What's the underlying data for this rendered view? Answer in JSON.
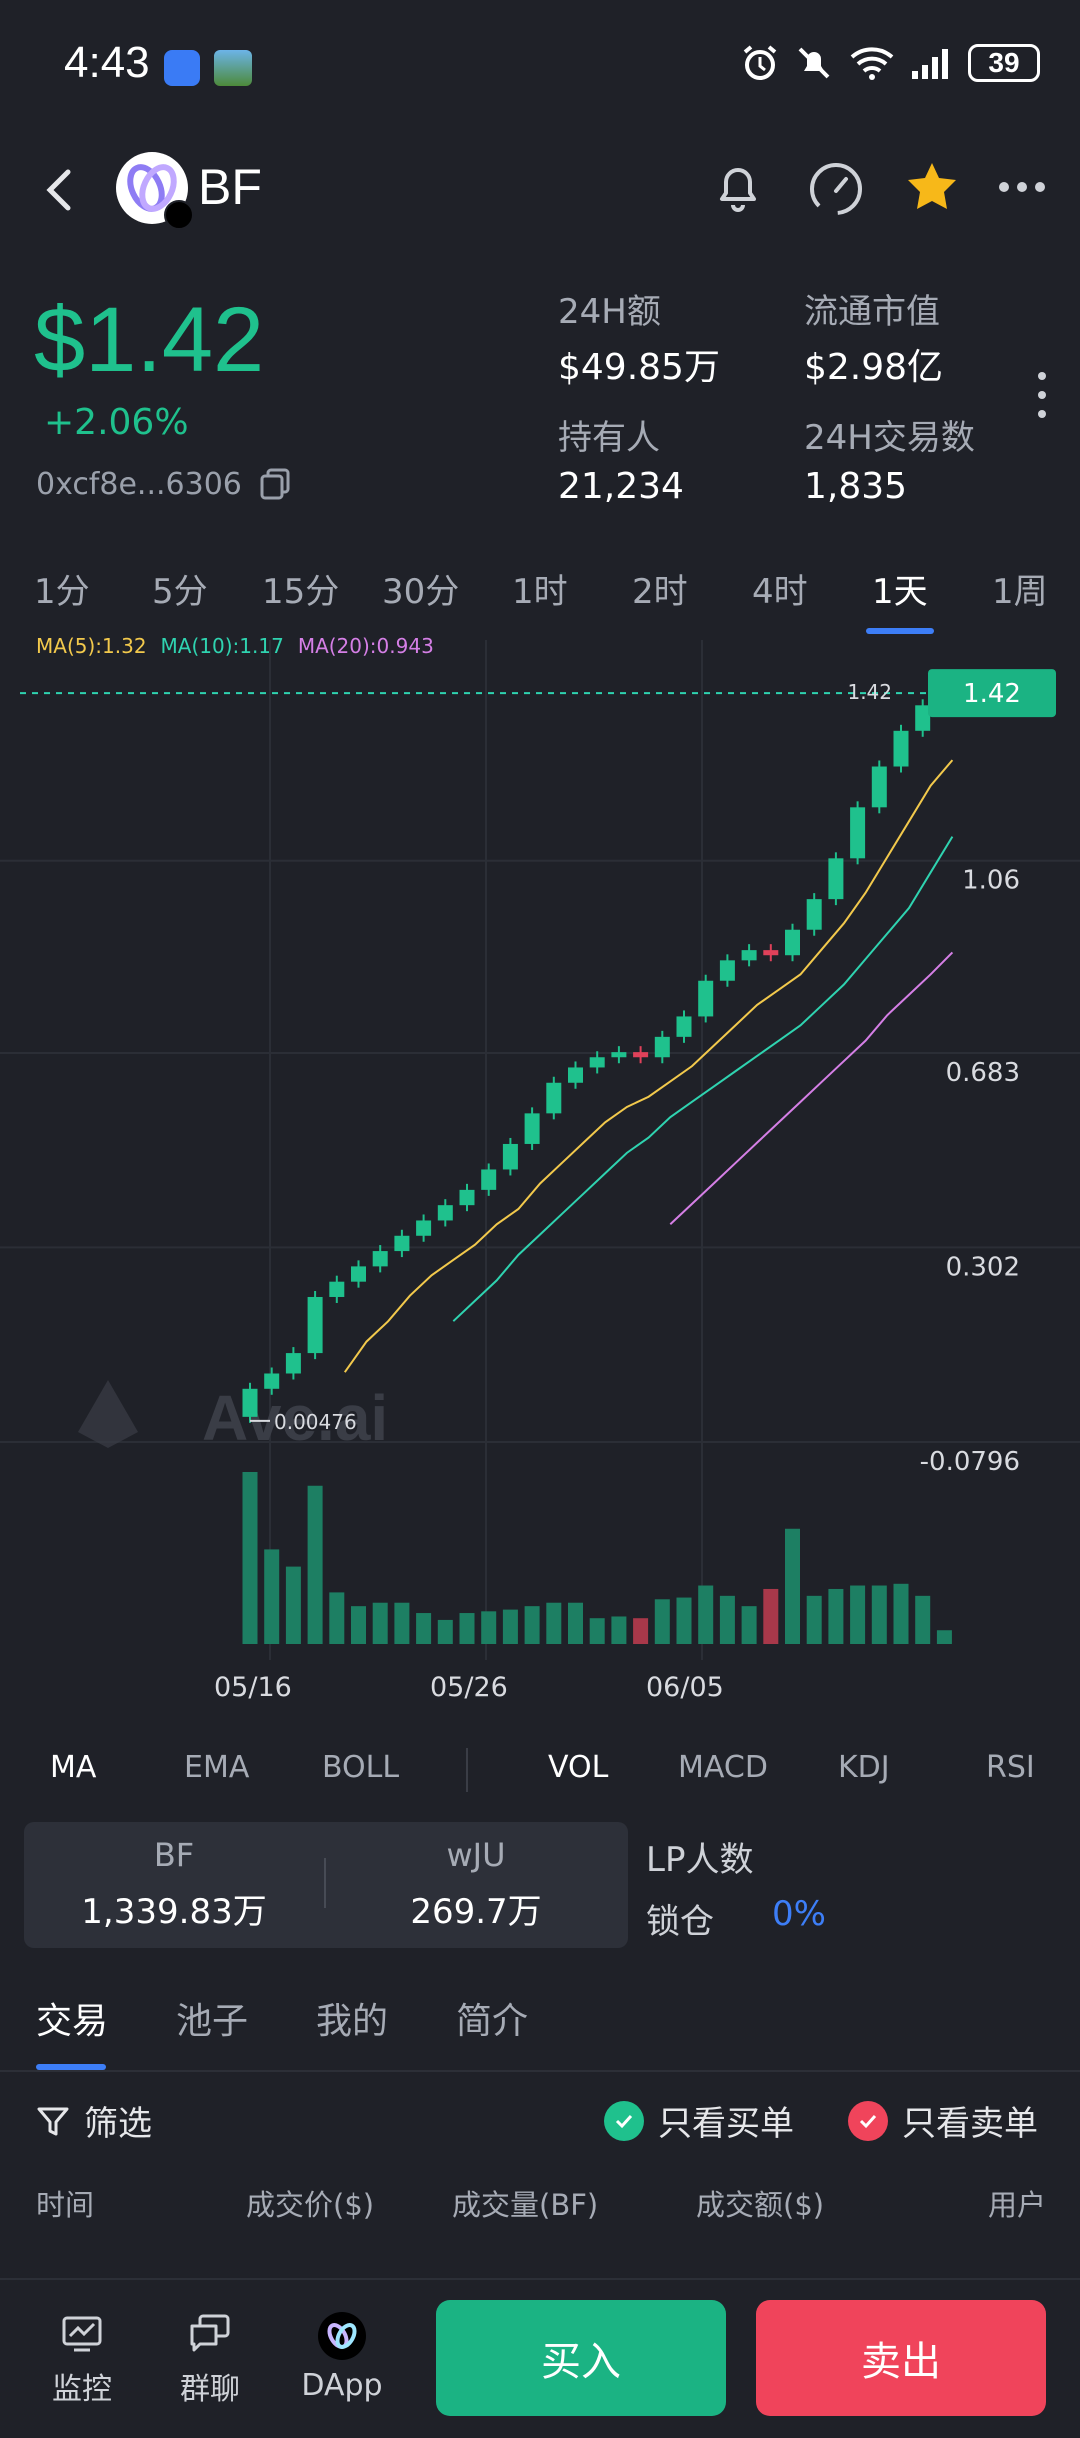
{
  "status": {
    "time": "4:43",
    "battery": "39"
  },
  "header": {
    "symbol": "BF"
  },
  "price": {
    "value": "$1.42",
    "change": "+2.06%",
    "address": "0xcf8e...6306"
  },
  "stats": [
    {
      "label": "24H额",
      "value": "$49.85万"
    },
    {
      "label": "流通市值",
      "value": "$2.98亿"
    },
    {
      "label": "持有人",
      "value": "21,234"
    },
    {
      "label": "24H交易数",
      "value": "1,835"
    }
  ],
  "timeframes": [
    "1分",
    "5分",
    "15分",
    "30分",
    "1时",
    "2时",
    "4时",
    "1天",
    "1周"
  ],
  "active_timeframe": "1天",
  "ma_legend": {
    "ma5": "MA(5):1.32",
    "ma10": "MA(10):1.17",
    "ma20": "MA(20):0.943"
  },
  "chart_data": {
    "type": "candlestick",
    "y_ticks": [
      "1.06",
      "0.683",
      "0.302",
      "-0.0796"
    ],
    "current_price_label": "1.42",
    "high_label": "1.42",
    "low_label": "0.00476",
    "x_labels": [
      "05/16",
      "05/26",
      "06/05"
    ],
    "watermark": "Ave.ai",
    "ylim": [
      -0.0796,
      1.43
    ],
    "candles": [
      {
        "o": 0.005,
        "c": 0.06,
        "v": 1.0,
        "up": true
      },
      {
        "o": 0.06,
        "c": 0.09,
        "v": 0.55,
        "up": true
      },
      {
        "o": 0.09,
        "c": 0.13,
        "v": 0.45,
        "up": true
      },
      {
        "o": 0.13,
        "c": 0.24,
        "v": 0.92,
        "up": true
      },
      {
        "o": 0.24,
        "c": 0.27,
        "v": 0.3,
        "up": true
      },
      {
        "o": 0.27,
        "c": 0.3,
        "v": 0.22,
        "up": true
      },
      {
        "o": 0.3,
        "c": 0.33,
        "v": 0.24,
        "up": true
      },
      {
        "o": 0.33,
        "c": 0.36,
        "v": 0.24,
        "up": true
      },
      {
        "o": 0.36,
        "c": 0.39,
        "v": 0.18,
        "up": true
      },
      {
        "o": 0.39,
        "c": 0.42,
        "v": 0.14,
        "up": true
      },
      {
        "o": 0.42,
        "c": 0.45,
        "v": 0.18,
        "up": true
      },
      {
        "o": 0.45,
        "c": 0.49,
        "v": 0.19,
        "up": true
      },
      {
        "o": 0.49,
        "c": 0.54,
        "v": 0.2,
        "up": true
      },
      {
        "o": 0.54,
        "c": 0.6,
        "v": 0.22,
        "up": true
      },
      {
        "o": 0.6,
        "c": 0.66,
        "v": 0.24,
        "up": true
      },
      {
        "o": 0.66,
        "c": 0.69,
        "v": 0.24,
        "up": true
      },
      {
        "o": 0.69,
        "c": 0.71,
        "v": 0.15,
        "up": true
      },
      {
        "o": 0.71,
        "c": 0.72,
        "v": 0.16,
        "up": true
      },
      {
        "o": 0.72,
        "c": 0.71,
        "v": 0.15,
        "up": false
      },
      {
        "o": 0.71,
        "c": 0.75,
        "v": 0.26,
        "up": true
      },
      {
        "o": 0.75,
        "c": 0.79,
        "v": 0.27,
        "up": true
      },
      {
        "o": 0.79,
        "c": 0.86,
        "v": 0.34,
        "up": true
      },
      {
        "o": 0.86,
        "c": 0.9,
        "v": 0.28,
        "up": true
      },
      {
        "o": 0.9,
        "c": 0.92,
        "v": 0.22,
        "up": true
      },
      {
        "o": 0.92,
        "c": 0.91,
        "v": 0.32,
        "up": false
      },
      {
        "o": 0.91,
        "c": 0.96,
        "v": 0.67,
        "up": true
      },
      {
        "o": 0.96,
        "c": 1.02,
        "v": 0.28,
        "up": true
      },
      {
        "o": 1.02,
        "c": 1.1,
        "v": 0.32,
        "up": true
      },
      {
        "o": 1.1,
        "c": 1.2,
        "v": 0.34,
        "up": true
      },
      {
        "o": 1.2,
        "c": 1.28,
        "v": 0.34,
        "up": true
      },
      {
        "o": 1.28,
        "c": 1.35,
        "v": 0.35,
        "up": true
      },
      {
        "o": 1.35,
        "c": 1.4,
        "v": 0.28,
        "up": true
      },
      {
        "o": 1.4,
        "c": 1.42,
        "v": 0.08,
        "up": true
      }
    ],
    "ma5": [
      null,
      null,
      null,
      null,
      0.12,
      0.18,
      0.22,
      0.27,
      0.31,
      0.34,
      0.37,
      0.41,
      0.44,
      0.49,
      0.53,
      0.57,
      0.61,
      0.64,
      0.66,
      0.69,
      0.72,
      0.76,
      0.8,
      0.84,
      0.87,
      0.9,
      0.95,
      1.0,
      1.06,
      1.13,
      1.2,
      1.27,
      1.32
    ],
    "ma10": [
      null,
      null,
      null,
      null,
      null,
      null,
      null,
      null,
      null,
      0.22,
      0.26,
      0.3,
      0.35,
      0.39,
      0.43,
      0.47,
      0.51,
      0.55,
      0.58,
      0.62,
      0.65,
      0.68,
      0.71,
      0.74,
      0.77,
      0.8,
      0.84,
      0.88,
      0.93,
      0.98,
      1.03,
      1.1,
      1.17
    ],
    "ma20": [
      null,
      null,
      null,
      null,
      null,
      null,
      null,
      null,
      null,
      null,
      null,
      null,
      null,
      null,
      null,
      null,
      null,
      null,
      null,
      0.41,
      0.45,
      0.49,
      0.53,
      0.57,
      0.61,
      0.65,
      0.69,
      0.73,
      0.77,
      0.82,
      0.86,
      0.9,
      0.943
    ]
  },
  "indicator_tabs": [
    "MA",
    "EMA",
    "BOLL",
    "VOL",
    "MACD",
    "KDJ",
    "RSI"
  ],
  "pool": {
    "token_a": {
      "name": "BF",
      "amount": "1,339.83万"
    },
    "token_b": {
      "name": "wJU",
      "amount": "269.7万"
    },
    "lp_label": "LP人数",
    "lock_label": "锁仓",
    "lock_value": "0%"
  },
  "section_tabs": [
    "交易",
    "池子",
    "我的",
    "简介"
  ],
  "filter": {
    "label": "筛选",
    "buy_only": "只看买单",
    "sell_only": "只看卖单"
  },
  "columns": [
    "时间",
    "成交价($)",
    "成交量(BF)",
    "成交额($)",
    "用户"
  ],
  "bottom_nav": [
    {
      "label": "监控",
      "icon": "monitor-icon"
    },
    {
      "label": "群聊",
      "icon": "chat-icon"
    },
    {
      "label": "DApp",
      "icon": "dapp-icon"
    }
  ],
  "actions": {
    "buy": "买入",
    "sell": "卖出"
  },
  "colors": {
    "up": "#1fc18d",
    "down": "#e0415a",
    "accent": "#3d7ef7",
    "ma5": "#f2c94c",
    "ma10": "#2fd3b0",
    "ma20": "#d57fe6"
  }
}
